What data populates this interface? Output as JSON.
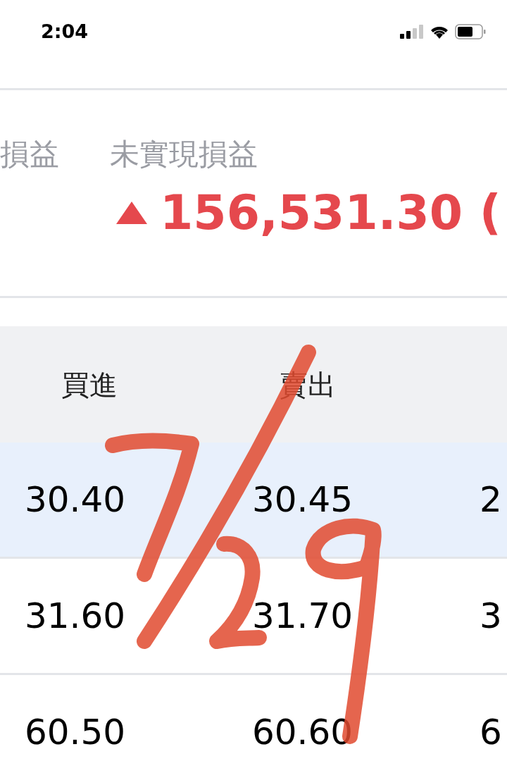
{
  "status_bar": {
    "time": "2:04"
  },
  "summary": {
    "labels": [
      "損益",
      "未實現損益"
    ],
    "unrealized_value": "156,531.30 ("
  },
  "table": {
    "columns": [
      "買進",
      "賣出"
    ],
    "rows": [
      {
        "cells": [
          "30.40",
          "30.45",
          "2"
        ],
        "selected": true
      },
      {
        "cells": [
          "31.60",
          "31.70",
          "3"
        ],
        "selected": false
      },
      {
        "cells": [
          "60.50",
          "60.60",
          "6"
        ],
        "selected": false
      }
    ]
  }
}
